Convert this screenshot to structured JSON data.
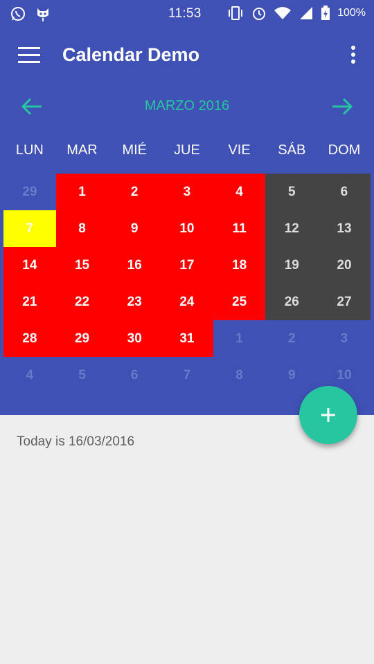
{
  "status_bar": {
    "time": "11:53",
    "battery": "100%",
    "icons": [
      "whatsapp-icon",
      "cat-icon",
      "vibrate-icon",
      "alarm-icon",
      "wifi-icon",
      "signal-icon",
      "battery-charging-icon"
    ]
  },
  "app_bar": {
    "title": "Calendar Demo",
    "menu_icon": "hamburger-icon",
    "overflow_icon": "more-vertical-icon"
  },
  "calendar": {
    "month_label": "MARZO 2016",
    "weekdays": [
      "LUN",
      "MAR",
      "MIÉ",
      "JUE",
      "VIE",
      "SÁB",
      "DOM"
    ],
    "days": [
      {
        "d": "29",
        "s": "other"
      },
      {
        "d": "1",
        "s": "red"
      },
      {
        "d": "2",
        "s": "red"
      },
      {
        "d": "3",
        "s": "red"
      },
      {
        "d": "4",
        "s": "red"
      },
      {
        "d": "5",
        "s": "gray"
      },
      {
        "d": "6",
        "s": "gray"
      },
      {
        "d": "7",
        "s": "yellow"
      },
      {
        "d": "8",
        "s": "red"
      },
      {
        "d": "9",
        "s": "red"
      },
      {
        "d": "10",
        "s": "red"
      },
      {
        "d": "11",
        "s": "red"
      },
      {
        "d": "12",
        "s": "gray"
      },
      {
        "d": "13",
        "s": "gray"
      },
      {
        "d": "14",
        "s": "red"
      },
      {
        "d": "15",
        "s": "red"
      },
      {
        "d": "16",
        "s": "red"
      },
      {
        "d": "17",
        "s": "red"
      },
      {
        "d": "18",
        "s": "red"
      },
      {
        "d": "19",
        "s": "gray"
      },
      {
        "d": "20",
        "s": "gray"
      },
      {
        "d": "21",
        "s": "red"
      },
      {
        "d": "22",
        "s": "red"
      },
      {
        "d": "23",
        "s": "red"
      },
      {
        "d": "24",
        "s": "red"
      },
      {
        "d": "25",
        "s": "red"
      },
      {
        "d": "26",
        "s": "gray"
      },
      {
        "d": "27",
        "s": "gray"
      },
      {
        "d": "28",
        "s": "red"
      },
      {
        "d": "29",
        "s": "red"
      },
      {
        "d": "30",
        "s": "red"
      },
      {
        "d": "31",
        "s": "red"
      },
      {
        "d": "1",
        "s": "other"
      },
      {
        "d": "2",
        "s": "other"
      },
      {
        "d": "3",
        "s": "other"
      },
      {
        "d": "4",
        "s": "other"
      },
      {
        "d": "5",
        "s": "other"
      },
      {
        "d": "6",
        "s": "other"
      },
      {
        "d": "7",
        "s": "other"
      },
      {
        "d": "8",
        "s": "other"
      },
      {
        "d": "9",
        "s": "other"
      },
      {
        "d": "10",
        "s": "other"
      }
    ]
  },
  "colors": {
    "primary": "#3F51B5",
    "accent": "#26C6A0",
    "red": "#FF0000",
    "gray": "#444444",
    "yellow": "#FFFF00"
  },
  "today_text": "Today is 16/03/2016",
  "fab_icon": "plus-icon"
}
